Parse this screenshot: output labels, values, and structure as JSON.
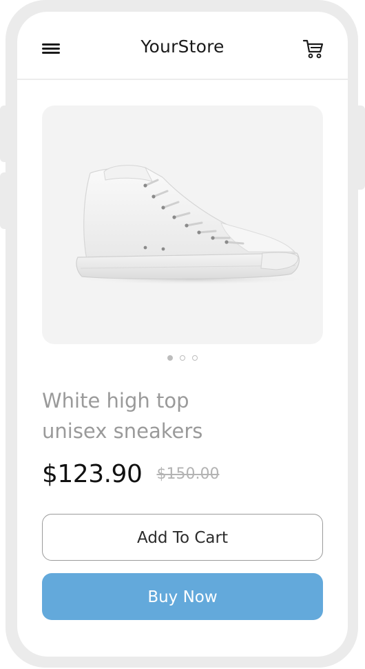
{
  "header": {
    "menu_icon": "hamburger-menu-icon",
    "title": "YourStore",
    "cart_icon": "shopping-cart-icon"
  },
  "product": {
    "image": "white-high-top-sneaker",
    "carousel": {
      "total": 3,
      "active_index": 0
    },
    "name_line_1": "White high top",
    "name_line_2": "unisex sneakers",
    "price": "$123.90",
    "original_price": "$150.00"
  },
  "actions": {
    "add_to_cart_label": "Add To Cart",
    "buy_now_label": "Buy Now"
  },
  "colors": {
    "accent": "#63a9db",
    "frame": "#ebebeb",
    "name_text": "#9a9a9a",
    "price_text": "#111111",
    "old_price_text": "#b3b3b3"
  }
}
